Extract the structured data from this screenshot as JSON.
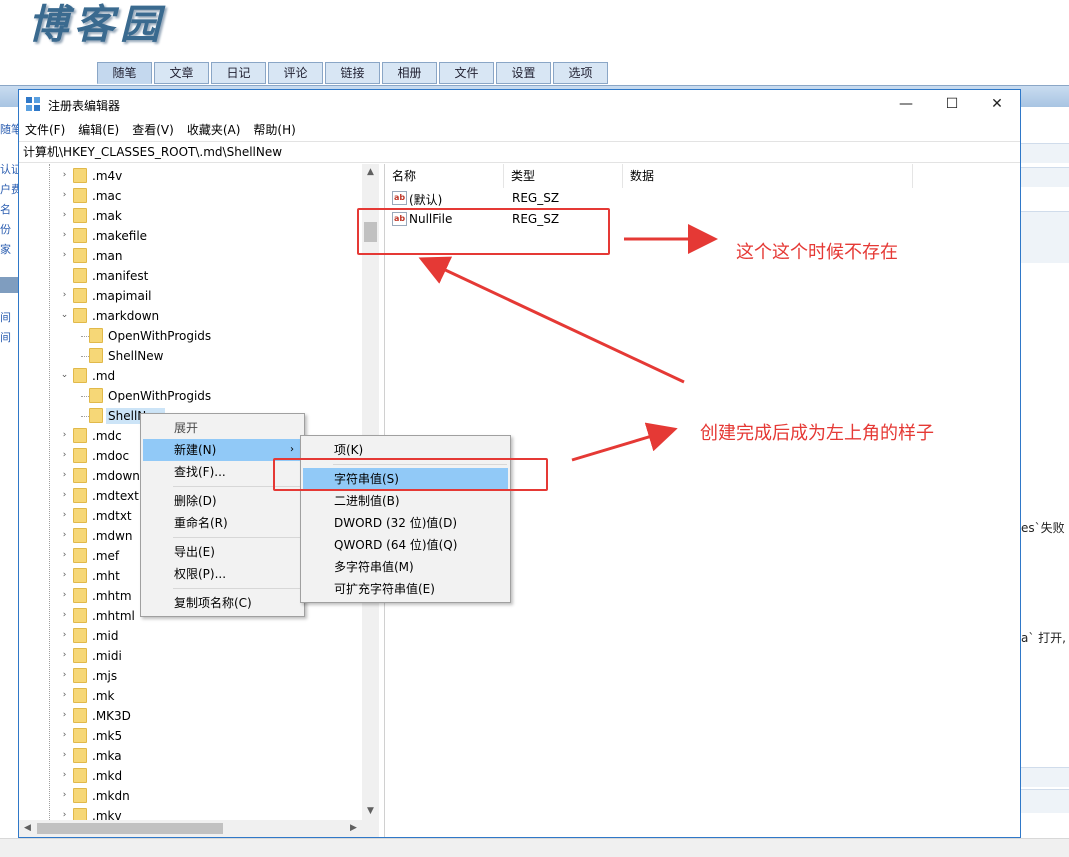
{
  "blog": {
    "logo": "博客园",
    "nav_tabs": [
      "随笔",
      "文章",
      "日记",
      "评论",
      "链接",
      "相册",
      "文件",
      "设置",
      "选项"
    ],
    "left_items": [
      "随笔",
      "认证",
      "户费",
      "名",
      "份",
      "家"
    ],
    "left_bottom_items": [
      "间",
      "间"
    ],
    "right_texts": [
      "es`失败",
      "a` 打开,"
    ]
  },
  "window": {
    "title": "注册表编辑器",
    "minimize": "—",
    "maximize": "☐",
    "close": "✕",
    "menu": [
      "文件(F)",
      "编辑(E)",
      "查看(V)",
      "收藏夹(A)",
      "帮助(H)"
    ],
    "address": "计算机\\HKEY_CLASSES_ROOT\\.md\\ShellNew"
  },
  "tree": {
    "items": [
      {
        "label": ".m4v",
        "level": 0,
        "expander": "›"
      },
      {
        "label": ".mac",
        "level": 0,
        "expander": "›"
      },
      {
        "label": ".mak",
        "level": 0,
        "expander": "›"
      },
      {
        "label": ".makefile",
        "level": 0,
        "expander": "›"
      },
      {
        "label": ".man",
        "level": 0,
        "expander": "›"
      },
      {
        "label": ".manifest",
        "level": 0,
        "expander": ""
      },
      {
        "label": ".mapimail",
        "level": 0,
        "expander": "›"
      },
      {
        "label": ".markdown",
        "level": 0,
        "expander": "⌄"
      },
      {
        "label": "OpenWithProgids",
        "level": 1,
        "expander": ""
      },
      {
        "label": "ShellNew",
        "level": 1,
        "expander": ""
      },
      {
        "label": ".md",
        "level": 0,
        "expander": "⌄"
      },
      {
        "label": "OpenWithProgids",
        "level": 1,
        "expander": ""
      },
      {
        "label": "ShellNew",
        "level": 1,
        "expander": "",
        "selected": true
      },
      {
        "label": ".mdc",
        "level": 0,
        "expander": "›"
      },
      {
        "label": ".mdoc",
        "level": 0,
        "expander": "›"
      },
      {
        "label": ".mdown",
        "level": 0,
        "expander": "›"
      },
      {
        "label": ".mdtext",
        "level": 0,
        "expander": "›"
      },
      {
        "label": ".mdtxt",
        "level": 0,
        "expander": "›"
      },
      {
        "label": ".mdwn",
        "level": 0,
        "expander": "›"
      },
      {
        "label": ".mef",
        "level": 0,
        "expander": "›"
      },
      {
        "label": ".mht",
        "level": 0,
        "expander": "›"
      },
      {
        "label": ".mhtm",
        "level": 0,
        "expander": "›"
      },
      {
        "label": ".mhtml",
        "level": 0,
        "expander": "›"
      },
      {
        "label": ".mid",
        "level": 0,
        "expander": "›"
      },
      {
        "label": ".midi",
        "level": 0,
        "expander": "›"
      },
      {
        "label": ".mjs",
        "level": 0,
        "expander": "›"
      },
      {
        "label": ".mk",
        "level": 0,
        "expander": "›"
      },
      {
        "label": ".MK3D",
        "level": 0,
        "expander": "›"
      },
      {
        "label": ".mk5",
        "level": 0,
        "expander": "›"
      },
      {
        "label": ".mka",
        "level": 0,
        "expander": "›"
      },
      {
        "label": ".mkd",
        "level": 0,
        "expander": "›"
      },
      {
        "label": ".mkdn",
        "level": 0,
        "expander": "›"
      },
      {
        "label": ".mkv",
        "level": 0,
        "expander": "›"
      }
    ]
  },
  "list": {
    "columns": [
      "名称",
      "类型",
      "数据"
    ],
    "rows": [
      {
        "icon": "ab",
        "name": "(默认)",
        "type": "REG_SZ",
        "data": ""
      },
      {
        "icon": "ab",
        "name": "NullFile",
        "type": "REG_SZ",
        "data": ""
      }
    ]
  },
  "context_menu": {
    "items": [
      {
        "label": "展开",
        "dim": true
      },
      {
        "label": "新建(N)",
        "highlight": true,
        "submenu": "›"
      },
      {
        "label": "查找(F)..."
      },
      {
        "label": "删除(D)"
      },
      {
        "label": "重命名(R)"
      },
      {
        "label": "导出(E)"
      },
      {
        "label": "权限(P)..."
      },
      {
        "label": "复制项名称(C)"
      }
    ]
  },
  "submenu": {
    "items": [
      {
        "label": "项(K)"
      },
      {
        "label": "字符串值(S)",
        "highlight": true
      },
      {
        "label": "二进制值(B)"
      },
      {
        "label": "DWORD (32 位)值(D)"
      },
      {
        "label": "QWORD (64 位)值(Q)"
      },
      {
        "label": "多字符串值(M)"
      },
      {
        "label": "可扩充字符串值(E)"
      }
    ]
  },
  "annotations": {
    "note1": "这个这个时候不存在",
    "note2": "创建完成后成为左上角的样子",
    "color": "#e53935"
  }
}
